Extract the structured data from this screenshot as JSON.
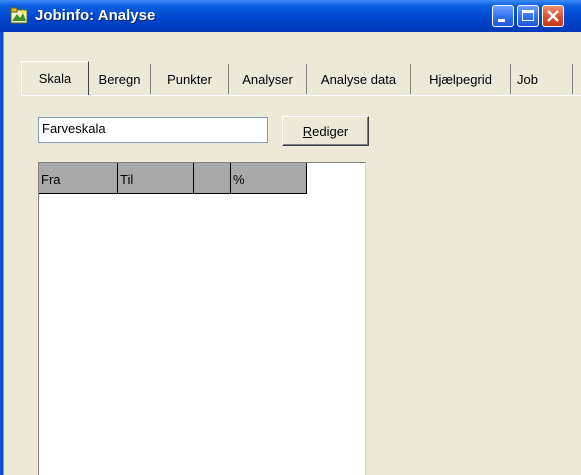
{
  "window": {
    "title": "Jobinfo: Analyse"
  },
  "tabs": [
    {
      "label": "Skala"
    },
    {
      "label": "Beregn"
    },
    {
      "label": "Punkter"
    },
    {
      "label": "Analyser"
    },
    {
      "label": "Analyse data"
    },
    {
      "label": "Hjælpegrid"
    },
    {
      "label": "Job"
    }
  ],
  "scale": {
    "name_value": "Farveskala",
    "edit_button_prefix": "",
    "edit_button_mnemonic": "R",
    "edit_button_rest": "ediger"
  },
  "grid": {
    "columns": [
      {
        "label": "Fra"
      },
      {
        "label": "Til"
      },
      {
        "label": ""
      },
      {
        "label": "%"
      }
    ]
  },
  "colors": {
    "titlebar": "#0047cf",
    "face": "#ece9d8",
    "grid_header": "#a9a9a9"
  }
}
